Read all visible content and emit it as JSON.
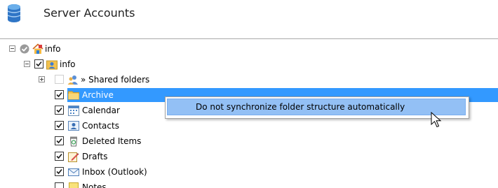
{
  "header": {
    "title": "Server Accounts",
    "icon": "database-icon"
  },
  "tree": {
    "nodes": [
      {
        "label": "info",
        "level": 0,
        "expander": "collapse",
        "check": "status-ok",
        "icon": "account-home-icon"
      },
      {
        "label": "info",
        "level": 1,
        "expander": "collapse",
        "check": "checked",
        "icon": "mailbox-user-icon"
      },
      {
        "label": "» Shared folders",
        "level": 2,
        "expander": "expand",
        "check": "unchecked",
        "icon": "shared-users-icon"
      },
      {
        "label": "Archive",
        "level": 3,
        "check": "checked",
        "icon": "folder-icon",
        "selected": true
      },
      {
        "label": "Calendar",
        "level": 3,
        "check": "checked",
        "icon": "calendar-icon"
      },
      {
        "label": "Contacts",
        "level": 3,
        "check": "checked",
        "icon": "contacts-icon"
      },
      {
        "label": "Deleted Items",
        "level": 3,
        "check": "checked",
        "icon": "recycle-bin-icon"
      },
      {
        "label": "Drafts",
        "level": 3,
        "check": "checked",
        "icon": "drafts-icon"
      },
      {
        "label": "Inbox (Outlook)",
        "level": 3,
        "check": "checked",
        "icon": "inbox-icon"
      },
      {
        "label": "Notes",
        "level": 3,
        "check": "unchecked",
        "icon": "notes-icon"
      }
    ]
  },
  "context_menu": {
    "items": [
      {
        "label": "Do not synchronize folder structure automatically",
        "highlighted": true
      }
    ]
  },
  "colors": {
    "selection": "#3399ff",
    "menu_highlight": "#93c0f5"
  }
}
